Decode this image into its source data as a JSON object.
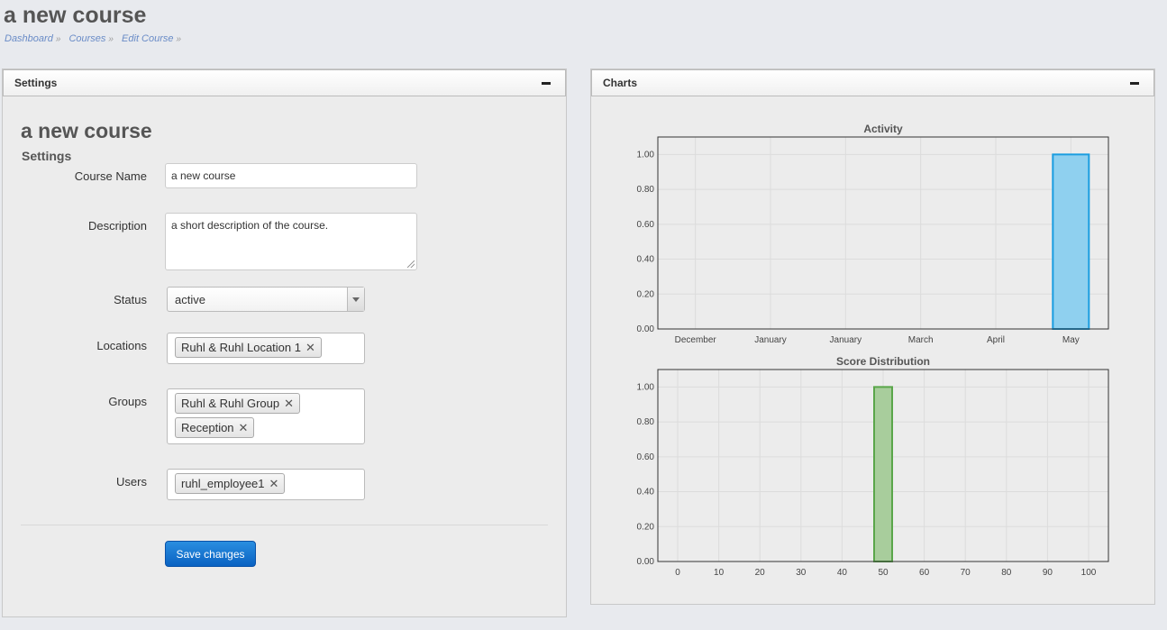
{
  "page": {
    "title": "a new course",
    "breadcrumb": [
      {
        "label": "Dashboard",
        "sep": "»"
      },
      {
        "label": "Courses",
        "sep": "»"
      },
      {
        "label": "Edit Course",
        "sep": "»"
      }
    ]
  },
  "settings_panel": {
    "header": "Settings",
    "form_title": "a new course",
    "form_subtitle": "Settings",
    "fields": {
      "course_name": {
        "label": "Course Name",
        "value": "a new course"
      },
      "description": {
        "label": "Description",
        "value": "a short description of the course."
      },
      "status": {
        "label": "Status",
        "value": "active"
      },
      "locations": {
        "label": "Locations",
        "tags": [
          "Ruhl & Ruhl Location 1"
        ]
      },
      "groups": {
        "label": "Groups",
        "tags": [
          "Ruhl & Ruhl Group",
          "Reception"
        ]
      },
      "users": {
        "label": "Users",
        "tags": [
          "ruhl_employee1"
        ]
      }
    },
    "save_label": "Save changes",
    "tag_remove_glyph": "✕"
  },
  "charts_panel": {
    "header": "Charts"
  },
  "chart_data": [
    {
      "type": "bar",
      "title": "Activity",
      "categories": [
        "December",
        "January",
        "January",
        "March",
        "April",
        "May"
      ],
      "values": [
        0,
        0,
        0,
        0,
        0,
        1
      ],
      "ylim": [
        0,
        1.1
      ],
      "yticks": [
        "0.00",
        "0.20",
        "0.40",
        "0.60",
        "0.80",
        "1.00"
      ],
      "grid": true,
      "color": "#8fd0ef",
      "stroke": "#1a9de0"
    },
    {
      "type": "bar",
      "title": "Score Distribution",
      "x": [
        0,
        10,
        20,
        30,
        40,
        50,
        60,
        70,
        80,
        90,
        100
      ],
      "bars": [
        {
          "x": 50,
          "value": 1
        }
      ],
      "ylim": [
        0,
        1.1
      ],
      "yticks": [
        "0.00",
        "0.20",
        "0.40",
        "0.60",
        "0.80",
        "1.00"
      ],
      "grid": true,
      "color": "#a8cd9c",
      "stroke": "#5aa64a"
    }
  ]
}
